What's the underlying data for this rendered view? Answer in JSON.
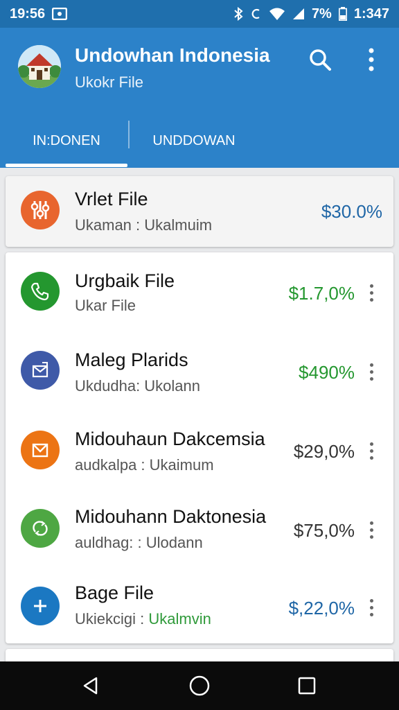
{
  "status_bar": {
    "time_left": "19:56",
    "battery_percent": "7%",
    "time_right": "1:347",
    "icons": [
      "cast-icon",
      "bluetooth-icon",
      "sync-icon",
      "wifi-icon",
      "signal-icon",
      "battery-icon"
    ]
  },
  "app_bar": {
    "title": "Undowhan Indonesia",
    "subtitle": "Ukokr File",
    "actions": [
      "search-icon",
      "more-vert-icon"
    ]
  },
  "tabs": [
    {
      "label": "IN:DONEN",
      "active": true
    },
    {
      "label": "UNDDOWAN",
      "active": false
    }
  ],
  "highlight_item": {
    "title": "Vrlet File",
    "subtitle": "Ukaman : Ukalmuim",
    "value": "$30.0%",
    "icon": "settings-sliders-icon",
    "color": "#e8652e"
  },
  "items": [
    {
      "title": "Urgbaik File",
      "subtitle": "Ukar File",
      "subtitle_accent": "",
      "value": "$1.7,0%",
      "icon": "phone-icon",
      "color": "#24972f",
      "value_color": "#24972f"
    },
    {
      "title": "Maleg Plarids",
      "subtitle": "Ukdudha: Ukolann",
      "subtitle_accent": "",
      "value": "$490%",
      "icon": "mail-out-icon",
      "color": "#3f5aa8",
      "value_color": "#24972f"
    },
    {
      "title": "Midouhaun Dakcemsia",
      "subtitle": "audkalpa : Ukaimum",
      "subtitle_accent": "",
      "value": "$29,0%",
      "icon": "mail-icon",
      "color": "#ec7414",
      "value_color": "#333333"
    },
    {
      "title": "Midouhann Daktonesia",
      "subtitle": "auldhag: : Ulodann",
      "subtitle_accent": "",
      "value": "$75,0%",
      "icon": "refresh-icon",
      "color": "#4ea743",
      "value_color": "#333333"
    },
    {
      "title": "Bage File",
      "subtitle": "Ukiekcigi : ",
      "subtitle_accent": "Ukalmvin",
      "value": "$,22,0%",
      "icon": "plus-icon",
      "color": "#1b78c2",
      "value_color": "#1f66a6"
    }
  ],
  "nav_bar": {
    "buttons": [
      "back-icon",
      "home-icon",
      "recents-icon"
    ]
  }
}
